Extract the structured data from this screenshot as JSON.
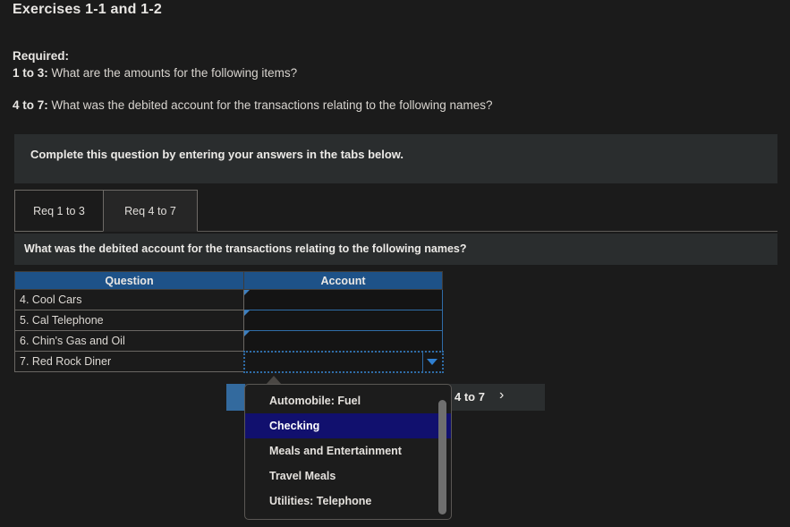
{
  "page": {
    "title": "Exercises 1-1 and 1-2",
    "required_label": "Required:",
    "req_1_3_label": "1 to 3:",
    "req_1_3_text": "What are the amounts for the following items?",
    "req_4_7_label": "4 to 7:",
    "req_4_7_text": "What was the debited account for the transactions relating to the following names?"
  },
  "instruction": {
    "text": "Complete this question by entering your answers in the tabs below."
  },
  "tabs": [
    {
      "label": "Req 1 to 3",
      "active": false
    },
    {
      "label": "Req 4 to 7",
      "active": true
    }
  ],
  "subquestion": {
    "text": "What was the debited account for the transactions relating to the following names?"
  },
  "table": {
    "headers": [
      "Question",
      "Account"
    ],
    "rows": [
      {
        "question": "4. Cool Cars",
        "account": ""
      },
      {
        "question": "5. Cal Telephone",
        "account": ""
      },
      {
        "question": "6. Chin's Gas and Oil",
        "account": ""
      },
      {
        "question": "7. Red Rock Diner",
        "account": ""
      }
    ]
  },
  "dropdown": {
    "options": [
      "Automobile: Fuel",
      "Checking",
      "Meals and Entertainment",
      "Travel Meals",
      "Utilities: Telephone"
    ],
    "selected": "Checking"
  },
  "navbar": {
    "label": "4 to 7",
    "chevron": "›"
  },
  "colors": {
    "page_background": "#1b1b1b",
    "panel_background": "#2a2d2e",
    "table_header_blue": "#1e5288",
    "cell_border_blue": "#2f6da8",
    "dropdown_selected_navy": "#11106e",
    "nav_accent_blue": "#336a9e"
  }
}
